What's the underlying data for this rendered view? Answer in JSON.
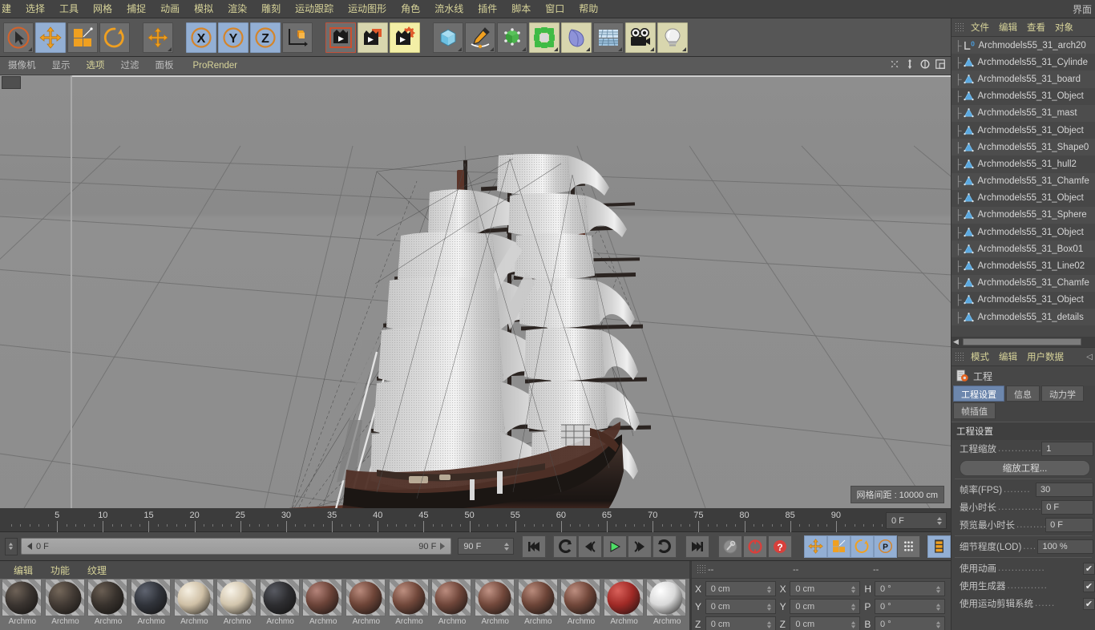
{
  "menubar": {
    "items": [
      "建",
      "选择",
      "工具",
      "网格",
      "捕捉",
      "动画",
      "模拟",
      "渲染",
      "雕刻",
      "运动跟踪",
      "运动图形",
      "角色",
      "流水线",
      "插件",
      "脚本",
      "窗口",
      "帮助"
    ],
    "layout_label": "界面"
  },
  "toolbar": {
    "icons": [
      {
        "name": "live-selection-tool",
        "state": "normal"
      },
      {
        "name": "move-tool",
        "state": "selected"
      },
      {
        "name": "scale-tool",
        "state": "normal"
      },
      {
        "name": "rotate-tool",
        "state": "normal"
      },
      {
        "name": "move-axis-tool",
        "state": "normal"
      },
      {
        "name": "axis-x-lock",
        "state": "selected"
      },
      {
        "name": "axis-y-lock",
        "state": "selected"
      },
      {
        "name": "axis-z-lock",
        "state": "selected"
      },
      {
        "name": "world-object-axis",
        "state": "normal"
      },
      {
        "name": "render-view",
        "state": "normal"
      },
      {
        "name": "render-region",
        "state": "olive"
      },
      {
        "name": "render-settings",
        "state": "cream"
      },
      {
        "name": "add-cube-object",
        "state": "normal"
      },
      {
        "name": "add-spline-pen",
        "state": "normal"
      },
      {
        "name": "add-generator",
        "state": "normal"
      },
      {
        "name": "add-mograph-cloner",
        "state": "olive"
      },
      {
        "name": "add-deformer",
        "state": "normal"
      },
      {
        "name": "add-scene-environment",
        "state": "normal"
      },
      {
        "name": "add-camera",
        "state": "olive"
      },
      {
        "name": "add-light",
        "state": "olive"
      }
    ]
  },
  "viewport": {
    "menus": [
      "摄像机",
      "显示",
      "选项",
      "过滤",
      "面板"
    ],
    "prorender": "ProRender",
    "grid_label": "网格间距 : 10000 cm",
    "header_icons": [
      "pan-icon",
      "dolly-icon",
      "orbit-icon",
      "maximize-icon"
    ],
    "scene_object": "sailing-ship-model"
  },
  "timeline": {
    "ticks": [
      5,
      10,
      15,
      20,
      25,
      30,
      35,
      40,
      45,
      50,
      55,
      60,
      65,
      70,
      75,
      80,
      85,
      90
    ],
    "current_frame_field": "0 F",
    "range_start": "0 F",
    "range_end": "90 F",
    "end_frame_field": "90 F",
    "transport": [
      {
        "name": "goto-start-button"
      },
      {
        "name": "loop-back-button"
      },
      {
        "name": "step-back-button"
      },
      {
        "name": "play-button"
      },
      {
        "name": "step-forward-button"
      },
      {
        "name": "loop-forward-button"
      },
      {
        "name": "goto-end-button"
      },
      {
        "name": "autokey-button"
      },
      {
        "name": "record-keyframe-button"
      },
      {
        "name": "keyframe-selection-button"
      }
    ],
    "mode_buttons": [
      {
        "name": "position-key-toggle",
        "state": "selected"
      },
      {
        "name": "scale-key-toggle",
        "state": "selected"
      },
      {
        "name": "rotation-key-toggle",
        "state": "selected"
      },
      {
        "name": "parameter-key-toggle",
        "state": "selected"
      },
      {
        "name": "point-level-anim-toggle",
        "state": "normal"
      },
      {
        "name": "timeline-toggle",
        "state": "selected"
      }
    ]
  },
  "materials": {
    "menus": [
      "编辑",
      "功能",
      "纹理"
    ],
    "items": [
      {
        "label": "Archmo",
        "color": "#3a3430",
        "highlight": "#6e6257"
      },
      {
        "label": "Archmo",
        "color": "#423a34",
        "highlight": "#74675a"
      },
      {
        "label": "Archmo",
        "color": "#38322d",
        "highlight": "#6a5e53"
      },
      {
        "label": "Archmo",
        "color": "#30333a",
        "highlight": "#5f6470"
      },
      {
        "label": "Archmo",
        "color": "#cfc0a6",
        "highlight": "#f6f0e2"
      },
      {
        "label": "Archmo",
        "color": "#d2c5ad",
        "highlight": "#f8f3e8"
      },
      {
        "label": "Archmo",
        "color": "#2d2d30",
        "highlight": "#585a62"
      },
      {
        "label": "Archmo",
        "color": "#6b4338",
        "highlight": "#b5847a"
      },
      {
        "label": "Archmo",
        "color": "#6d4437",
        "highlight": "#b98a7c"
      },
      {
        "label": "Archmo",
        "color": "#70473a",
        "highlight": "#bd8f80"
      },
      {
        "label": "Archmo",
        "color": "#6e4539",
        "highlight": "#bb8c7e"
      },
      {
        "label": "Archmo",
        "color": "#72483b",
        "highlight": "#c09284"
      },
      {
        "label": "Archmo",
        "color": "#6c4437",
        "highlight": "#b98b7c"
      },
      {
        "label": "Archmo",
        "color": "#704639",
        "highlight": "#bd8e80"
      },
      {
        "label": "Archmo",
        "color": "#a02a26",
        "highlight": "#d9615a"
      },
      {
        "label": "Archmo",
        "color": "#d8d8d8",
        "highlight": "#ffffff"
      }
    ]
  },
  "coordinates": {
    "headers": [
      "--",
      "--",
      "--"
    ],
    "rows": [
      {
        "label_a": "X",
        "value_a": "0 cm",
        "label_b": "X",
        "value_b": "0 cm",
        "label_c": "H",
        "value_c": "0 °"
      },
      {
        "label_a": "Y",
        "value_a": "0 cm",
        "label_b": "Y",
        "value_b": "0 cm",
        "label_c": "P",
        "value_c": "0 °"
      },
      {
        "label_a": "Z",
        "value_a": "0 cm",
        "label_b": "Z",
        "value_b": "0 cm",
        "label_c": "B",
        "value_c": "0 °"
      }
    ]
  },
  "object_manager": {
    "menus": [
      "文件",
      "编辑",
      "查看",
      "对象"
    ],
    "items": [
      {
        "label": "Archmodels55_31_arch20",
        "icon": "layer-zero-icon"
      },
      {
        "label": "Archmodels55_31_Cylinde",
        "icon": "polygon-object-icon"
      },
      {
        "label": "Archmodels55_31_board",
        "icon": "polygon-object-icon"
      },
      {
        "label": "Archmodels55_31_Object",
        "icon": "polygon-object-icon"
      },
      {
        "label": "Archmodels55_31_mast",
        "icon": "polygon-object-icon"
      },
      {
        "label": "Archmodels55_31_Object",
        "icon": "polygon-object-icon"
      },
      {
        "label": "Archmodels55_31_Shape0",
        "icon": "polygon-object-icon"
      },
      {
        "label": "Archmodels55_31_hull2",
        "icon": "polygon-object-icon"
      },
      {
        "label": "Archmodels55_31_Chamfe",
        "icon": "polygon-object-icon"
      },
      {
        "label": "Archmodels55_31_Object",
        "icon": "polygon-object-icon"
      },
      {
        "label": "Archmodels55_31_Sphere",
        "icon": "polygon-object-icon"
      },
      {
        "label": "Archmodels55_31_Object",
        "icon": "polygon-object-icon"
      },
      {
        "label": "Archmodels55_31_Box01",
        "icon": "polygon-object-icon"
      },
      {
        "label": "Archmodels55_31_Line02",
        "icon": "polygon-object-icon"
      },
      {
        "label": "Archmodels55_31_Chamfe",
        "icon": "polygon-object-icon"
      },
      {
        "label": "Archmodels55_31_Object",
        "icon": "polygon-object-icon"
      },
      {
        "label": "Archmodels55_31_details",
        "icon": "polygon-object-icon"
      }
    ]
  },
  "attribute_manager": {
    "menus": [
      "模式",
      "编辑",
      "用户数据"
    ],
    "title": "工程",
    "tabs": [
      "工程设置",
      "信息",
      "动力学"
    ],
    "tabs_row2": [
      "帧插值"
    ],
    "active_tab": "工程设置",
    "section_title": "工程设置",
    "fields": [
      {
        "label": "工程缩放",
        "value": "1",
        "type": "text"
      },
      {
        "label": "帧率(FPS)",
        "value": "30",
        "type": "text"
      },
      {
        "label": "最小时长",
        "value": "0 F",
        "type": "text"
      },
      {
        "label": "预览最小时长",
        "value": "0 F",
        "type": "text"
      },
      {
        "label": "细节程度(LOD)",
        "value": "100 %",
        "type": "text"
      },
      {
        "label": "使用动画",
        "value": "✔",
        "type": "check"
      },
      {
        "label": "使用生成器",
        "value": "✔",
        "type": "check"
      },
      {
        "label": "使用运动剪辑系统",
        "value": "✔",
        "type": "check"
      }
    ],
    "scale_button": "缩放工程..."
  }
}
